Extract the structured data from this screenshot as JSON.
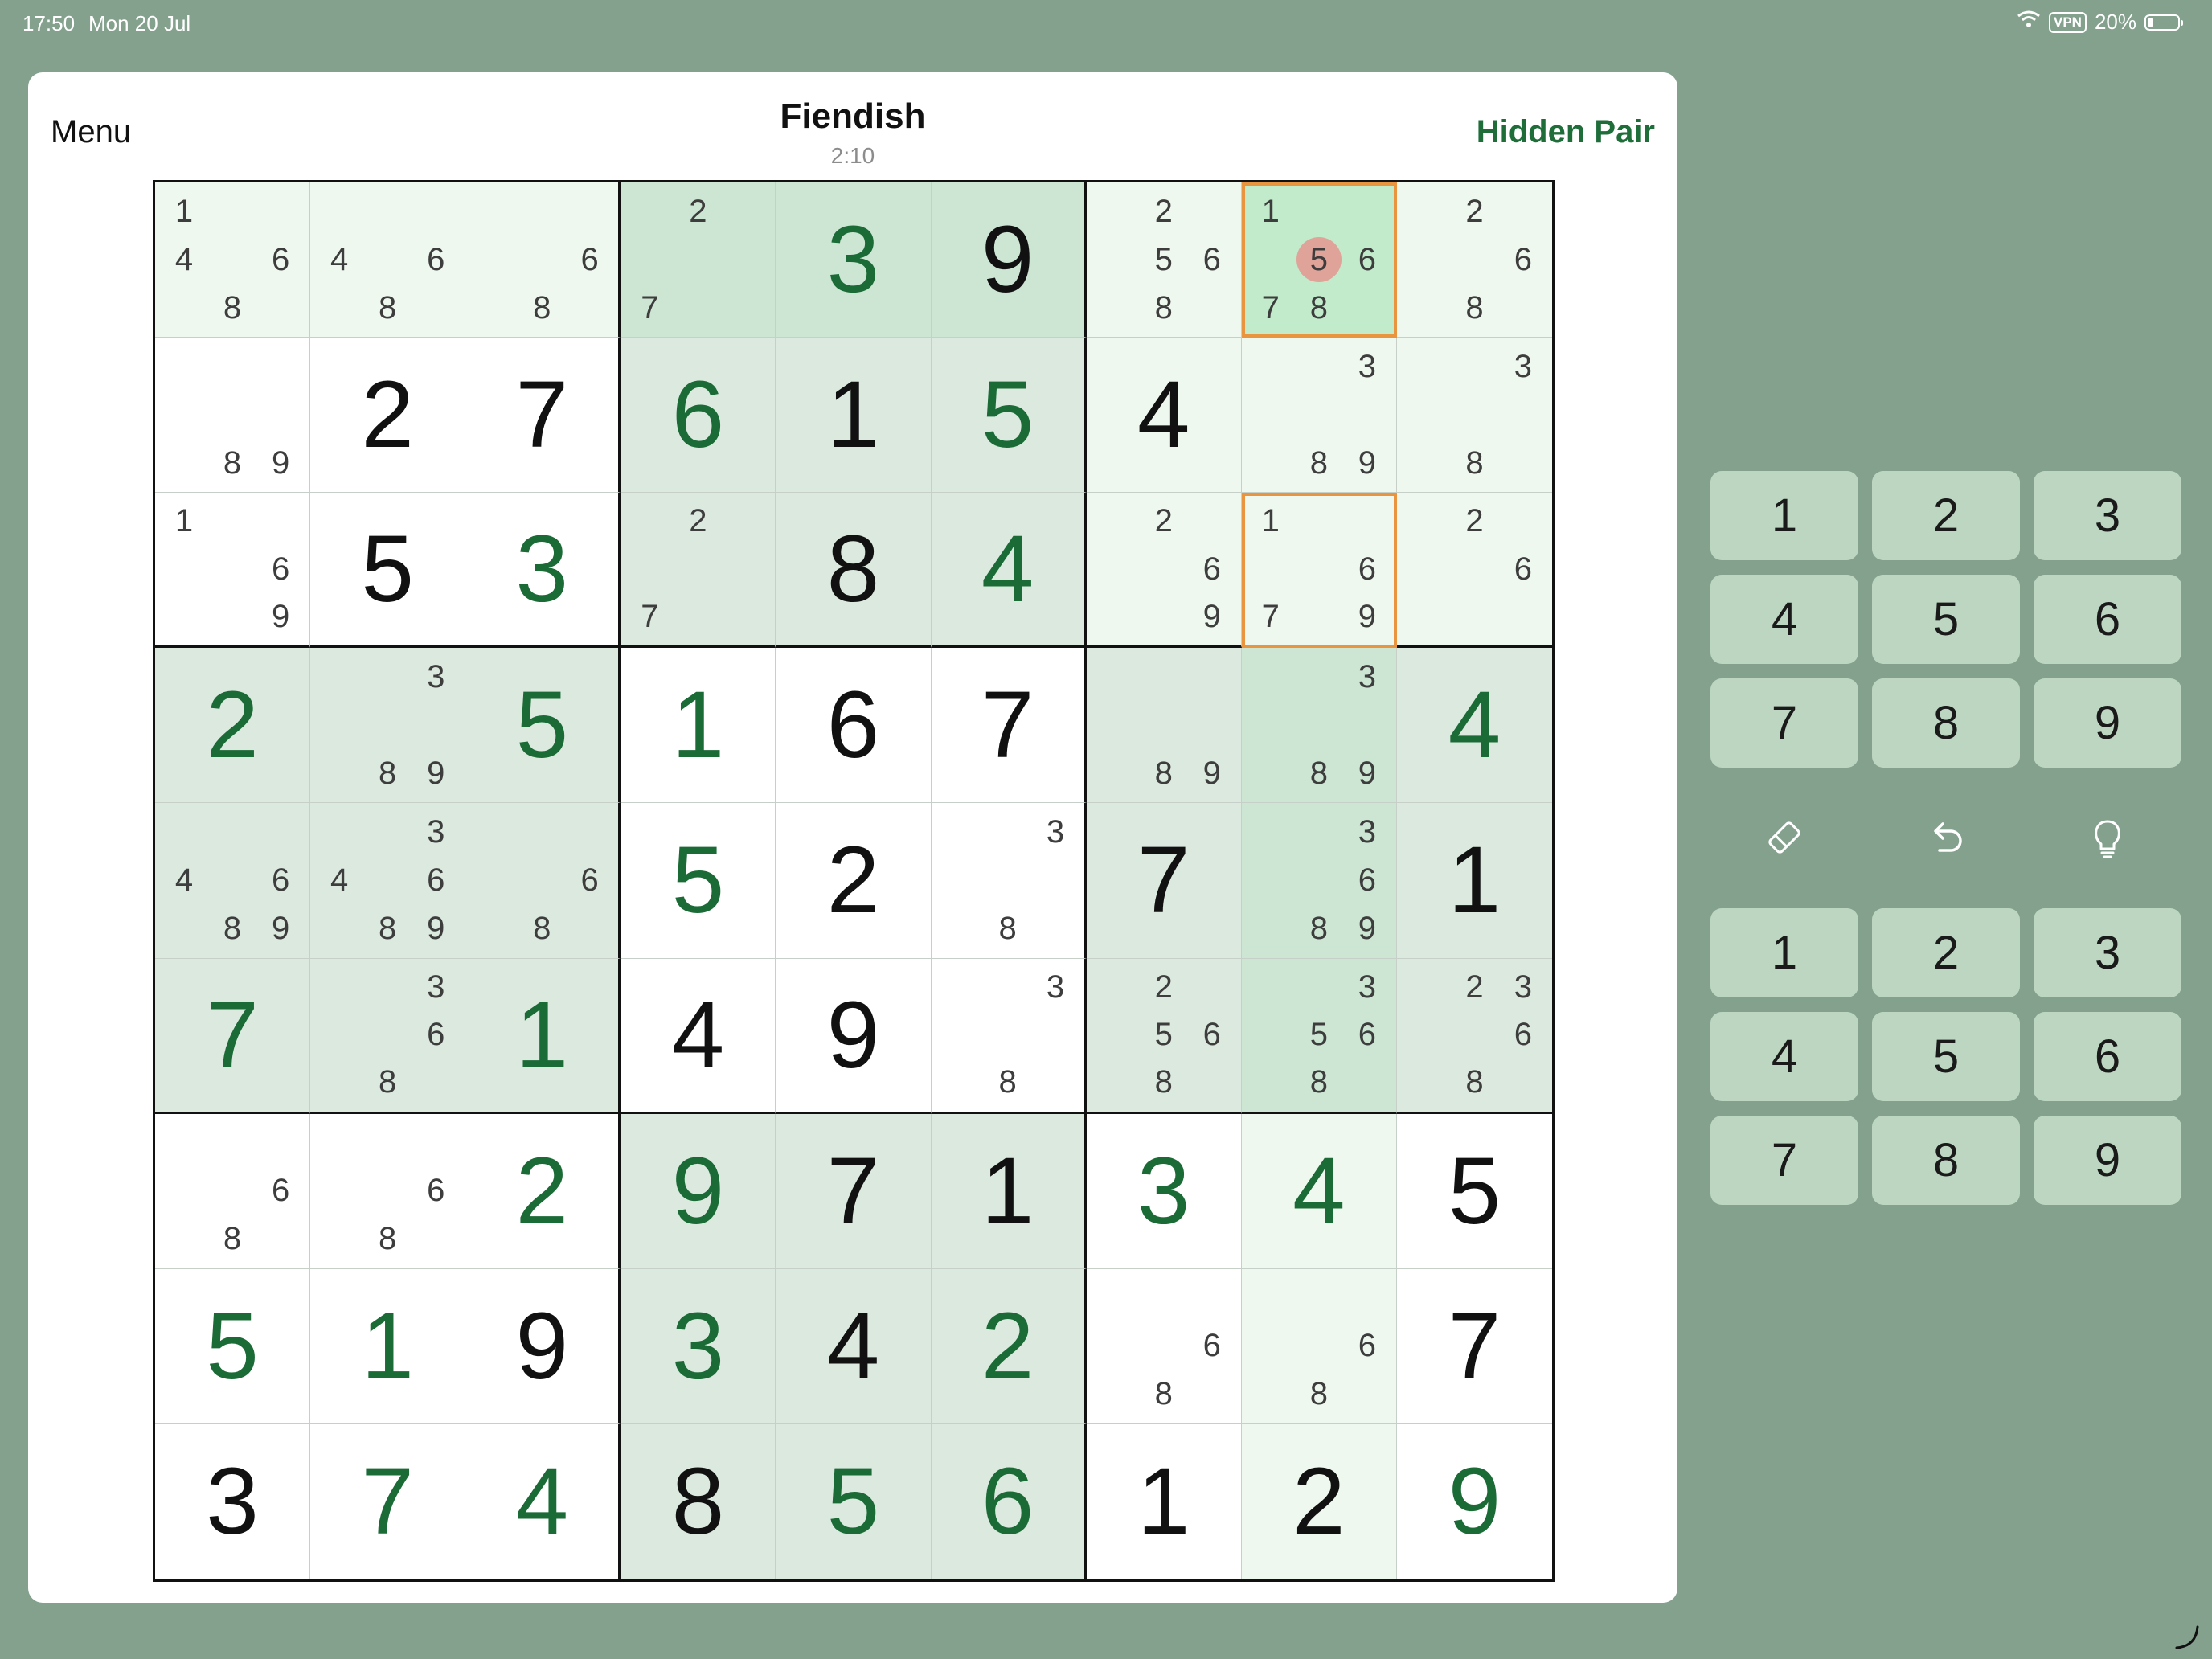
{
  "status_bar": {
    "time": "17:50",
    "date": "Mon 20 Jul",
    "vpn": "VPN",
    "battery": "20%"
  },
  "header": {
    "menu_label": "Menu",
    "title": "Fiendish",
    "timer": "2:10",
    "hint_label": "Hidden Pair"
  },
  "colors": {
    "background": "#84a18e",
    "accent_green": "#1f6e3a",
    "selection_border": "#e9953f",
    "note_focus": "#e0a39a",
    "key_bg": "#bcd6c1"
  },
  "board": {
    "values": [
      [
        "",
        "",
        "",
        "",
        "3",
        "9",
        "",
        "",
        ""
      ],
      [
        "",
        "2",
        "7",
        "6",
        "1",
        "5",
        "4",
        "",
        ""
      ],
      [
        "",
        "5",
        "3",
        "",
        "8",
        "4",
        "",
        "",
        ""
      ],
      [
        "2",
        "",
        "5",
        "1",
        "6",
        "7",
        "",
        "",
        "4"
      ],
      [
        "",
        "",
        "",
        "5",
        "2",
        "",
        "7",
        "",
        "1"
      ],
      [
        "7",
        "",
        "1",
        "4",
        "9",
        "",
        "",
        "",
        ""
      ],
      [
        "",
        "",
        "2",
        "9",
        "7",
        "1",
        "3",
        "4",
        "5"
      ],
      [
        "5",
        "1",
        "9",
        "3",
        "4",
        "2",
        "",
        "",
        "7"
      ],
      [
        "3",
        "7",
        "4",
        "8",
        "5",
        "6",
        "1",
        "2",
        "9"
      ]
    ],
    "value_kinds": [
      [
        "",
        "",
        "",
        "",
        "entered",
        "given",
        "",
        "",
        ""
      ],
      [
        "",
        "given",
        "given",
        "entered",
        "given",
        "entered",
        "given",
        "",
        ""
      ],
      [
        "",
        "given",
        "entered",
        "",
        "given",
        "entered",
        "",
        "",
        ""
      ],
      [
        "entered",
        "",
        "entered",
        "entered",
        "given",
        "given",
        "",
        "",
        "entered"
      ],
      [
        "",
        "",
        "",
        "entered",
        "given",
        "",
        "given",
        "",
        "given"
      ],
      [
        "entered",
        "",
        "entered",
        "given",
        "given",
        "",
        "",
        "",
        ""
      ],
      [
        "",
        "",
        "entered",
        "entered",
        "given",
        "given",
        "entered",
        "entered",
        "given"
      ],
      [
        "entered",
        "entered",
        "given",
        "entered",
        "given",
        "entered",
        "",
        "",
        "given"
      ],
      [
        "given",
        "entered",
        "entered",
        "given",
        "entered",
        "entered",
        "given",
        "given",
        "entered"
      ]
    ],
    "notes": [
      [
        [
          1,
          4,
          6,
          8
        ],
        [
          4,
          6,
          8
        ],
        [
          6,
          8
        ],
        [
          2,
          7
        ],
        [],
        [],
        [
          2,
          5,
          6,
          8
        ],
        [
          1,
          5,
          6,
          7,
          8
        ],
        [
          2,
          6,
          8
        ]
      ],
      [
        [
          8,
          9
        ],
        [],
        [],
        [],
        [],
        [],
        [],
        [
          3,
          8,
          9
        ],
        [
          3,
          8
        ]
      ],
      [
        [
          1,
          6,
          9
        ],
        [],
        [],
        [
          2,
          7
        ],
        [],
        [],
        [
          2,
          6,
          9
        ],
        [
          1,
          6,
          7,
          9
        ],
        [
          2,
          6
        ]
      ],
      [
        [],
        [
          3,
          8,
          9
        ],
        [],
        [],
        [],
        [],
        [
          8,
          9
        ],
        [
          3,
          8,
          9
        ],
        []
      ],
      [
        [
          4,
          6,
          8,
          9
        ],
        [
          3,
          4,
          6,
          8,
          9
        ],
        [
          6,
          8
        ],
        [],
        [],
        [
          3,
          8
        ],
        [],
        [
          3,
          6,
          8,
          9
        ],
        []
      ],
      [
        [],
        [
          3,
          6,
          8
        ],
        [],
        [],
        [],
        [
          3,
          8
        ],
        [
          2,
          5,
          6,
          8
        ],
        [
          3,
          5,
          6,
          8
        ],
        [
          2,
          3,
          6,
          8
        ]
      ],
      [
        [
          6,
          8
        ],
        [
          6,
          8
        ],
        [],
        [],
        [],
        [],
        [],
        [],
        []
      ],
      [
        [],
        [],
        [],
        [],
        [],
        [],
        [
          6,
          8
        ],
        [
          6,
          8
        ],
        []
      ],
      [
        [],
        [],
        [],
        [],
        [],
        [],
        [],
        [],
        []
      ]
    ],
    "shading": [
      [
        "hl",
        "hl",
        "hl",
        "box",
        "box",
        "box",
        "hl",
        "sel",
        "hl"
      ],
      [
        "",
        "",
        "",
        "peer",
        "peer",
        "peer",
        "hl",
        "hl",
        "hl"
      ],
      [
        "",
        "",
        "",
        "peer",
        "peer",
        "peer",
        "hl",
        "hl",
        "hl"
      ],
      [
        "peer",
        "peer",
        "peer",
        "",
        "",
        "",
        "peer",
        "box",
        "peer"
      ],
      [
        "peer",
        "peer",
        "peer",
        "",
        "",
        "",
        "peer",
        "box",
        "peer"
      ],
      [
        "peer",
        "peer",
        "peer",
        "",
        "",
        "",
        "peer",
        "box",
        "peer"
      ],
      [
        "",
        "",
        "",
        "peer",
        "peer",
        "peer",
        "",
        "hl",
        ""
      ],
      [
        "",
        "",
        "",
        "peer",
        "peer",
        "peer",
        "",
        "hl",
        ""
      ],
      [
        "",
        "",
        "",
        "peer",
        "peer",
        "peer",
        "",
        "hl",
        ""
      ]
    ],
    "focus_note": {
      "row": 0,
      "col": 7,
      "digit": 5
    },
    "framed_cells": [
      {
        "row": 0,
        "col": 7
      },
      {
        "row": 2,
        "col": 7
      }
    ]
  },
  "number_pad": [
    "1",
    "2",
    "3",
    "4",
    "5",
    "6",
    "7",
    "8",
    "9"
  ],
  "notes_pad": [
    "1",
    "2",
    "3",
    "4",
    "5",
    "6",
    "7",
    "8",
    "9"
  ],
  "tools": [
    {
      "name": "eraser-icon"
    },
    {
      "name": "undo-icon"
    },
    {
      "name": "hint-bulb-icon"
    }
  ]
}
